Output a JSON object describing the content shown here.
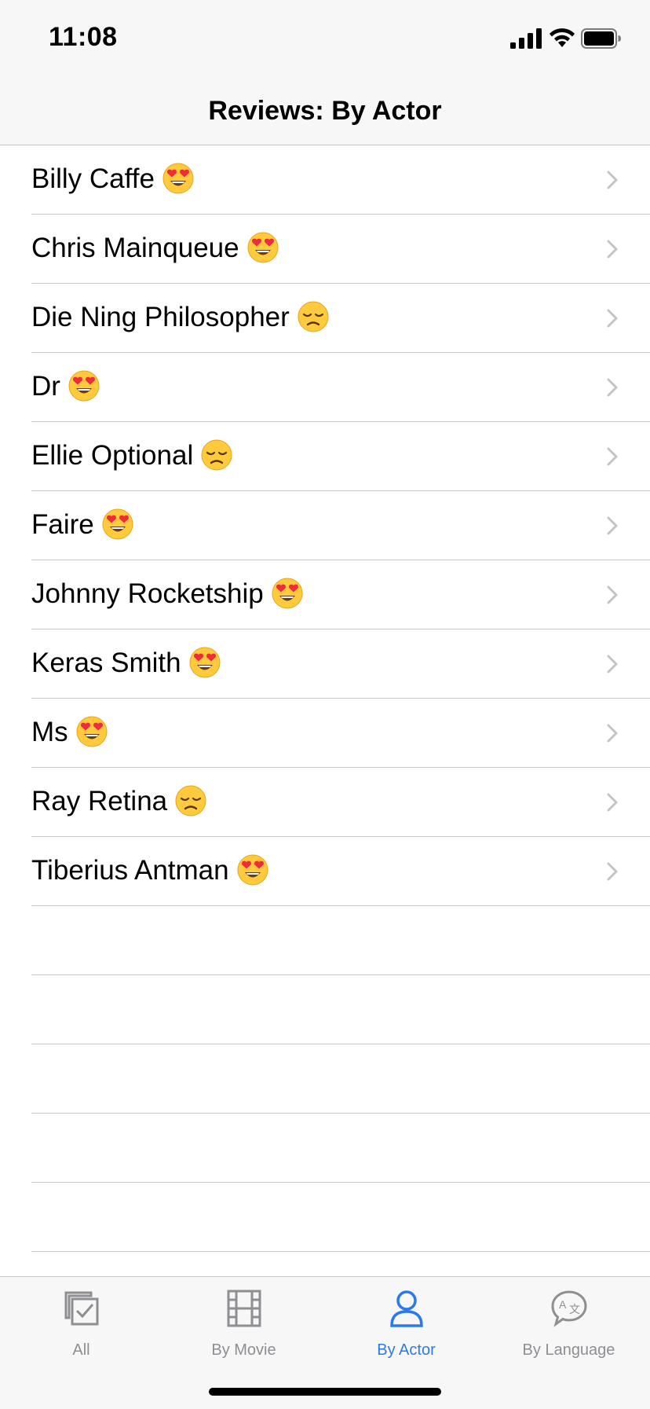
{
  "status_bar": {
    "time": "11:08"
  },
  "nav": {
    "title": "Reviews: By Actor"
  },
  "rows": [
    {
      "name": "Billy Caffe",
      "emoji": "heart-eyes"
    },
    {
      "name": "Chris Mainqueue",
      "emoji": "heart-eyes"
    },
    {
      "name": "Die Ning Philosopher",
      "emoji": "disappointed"
    },
    {
      "name": "Dr",
      "emoji": "heart-eyes"
    },
    {
      "name": "Ellie Optional",
      "emoji": "disappointed"
    },
    {
      "name": "Faire",
      "emoji": "heart-eyes"
    },
    {
      "name": "Johnny Rocketship",
      "emoji": "heart-eyes"
    },
    {
      "name": "Keras Smith",
      "emoji": "heart-eyes"
    },
    {
      "name": "Ms",
      "emoji": "heart-eyes"
    },
    {
      "name": "Ray Retina",
      "emoji": "disappointed"
    },
    {
      "name": "Tiberius Antman",
      "emoji": "heart-eyes"
    }
  ],
  "tabs": [
    {
      "label": "All",
      "icon": "checklist-icon",
      "active": false
    },
    {
      "label": "By Movie",
      "icon": "film-icon",
      "active": false
    },
    {
      "label": "By Actor",
      "icon": "person-icon",
      "active": true
    },
    {
      "label": "By Language",
      "icon": "translate-icon",
      "active": false
    }
  ],
  "colors": {
    "accent": "#2c7ae8",
    "inactive": "#8e8e93",
    "separator": "#c8c7cc"
  }
}
